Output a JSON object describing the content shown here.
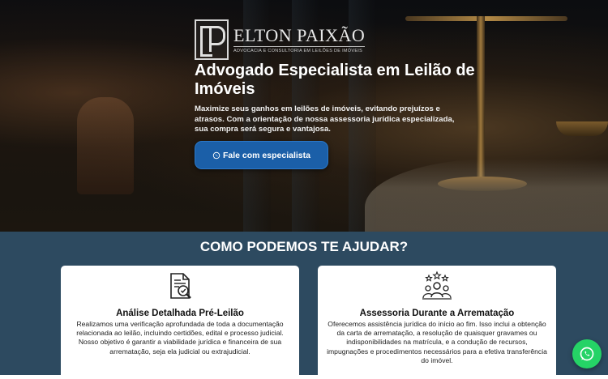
{
  "brand": {
    "name": "ELTON PAIXÃO",
    "tagline": "ADVOCACIA E CONSULTORIA EM LEILÕES DE IMÓVEIS"
  },
  "hero": {
    "title": "Advogado Especialista em Leilão de Imóveis",
    "description": "Maximize seus ganhos em leilões de imóveis, evitando prejuízos e atrasos. Com a orientação de nossa assessoria jurídica especializada, sua compra será segura e vantajosa.",
    "cta_label": "Fale com especialista",
    "cta_icon": "whatsapp-icon"
  },
  "services": {
    "title": "COMO PODEMOS TE AJUDAR?",
    "cards": [
      {
        "icon": "document-search-icon",
        "title": "Análise Detalhada Pré-Leilão",
        "text": "Realizamos uma verificação aprofundada de toda a documentação relacionada ao leilão, incluindo certidões, edital e processo judicial. Nosso objetivo é garantir a viabilidade jurídica e financeira de sua arrematação, seja ela judicial ou extrajudicial."
      },
      {
        "icon": "team-stars-icon",
        "title": "Assessoria Durante a Arrematação",
        "text": "Oferecemos assistência jurídica do início ao fim. Isso inclui a obtenção da carta de arrematação, a resolução de quaisquer gravames ou indisponibilidades na matrícula, e a condução de recursos, impugnações e procedimentos necessários para a efetiva transferência do imóvel."
      }
    ]
  },
  "floating_button": {
    "icon": "whatsapp-icon"
  },
  "colors": {
    "cta": "#1b5fa8",
    "services_bg": "#2d4a60",
    "whatsapp": "#25d366"
  }
}
